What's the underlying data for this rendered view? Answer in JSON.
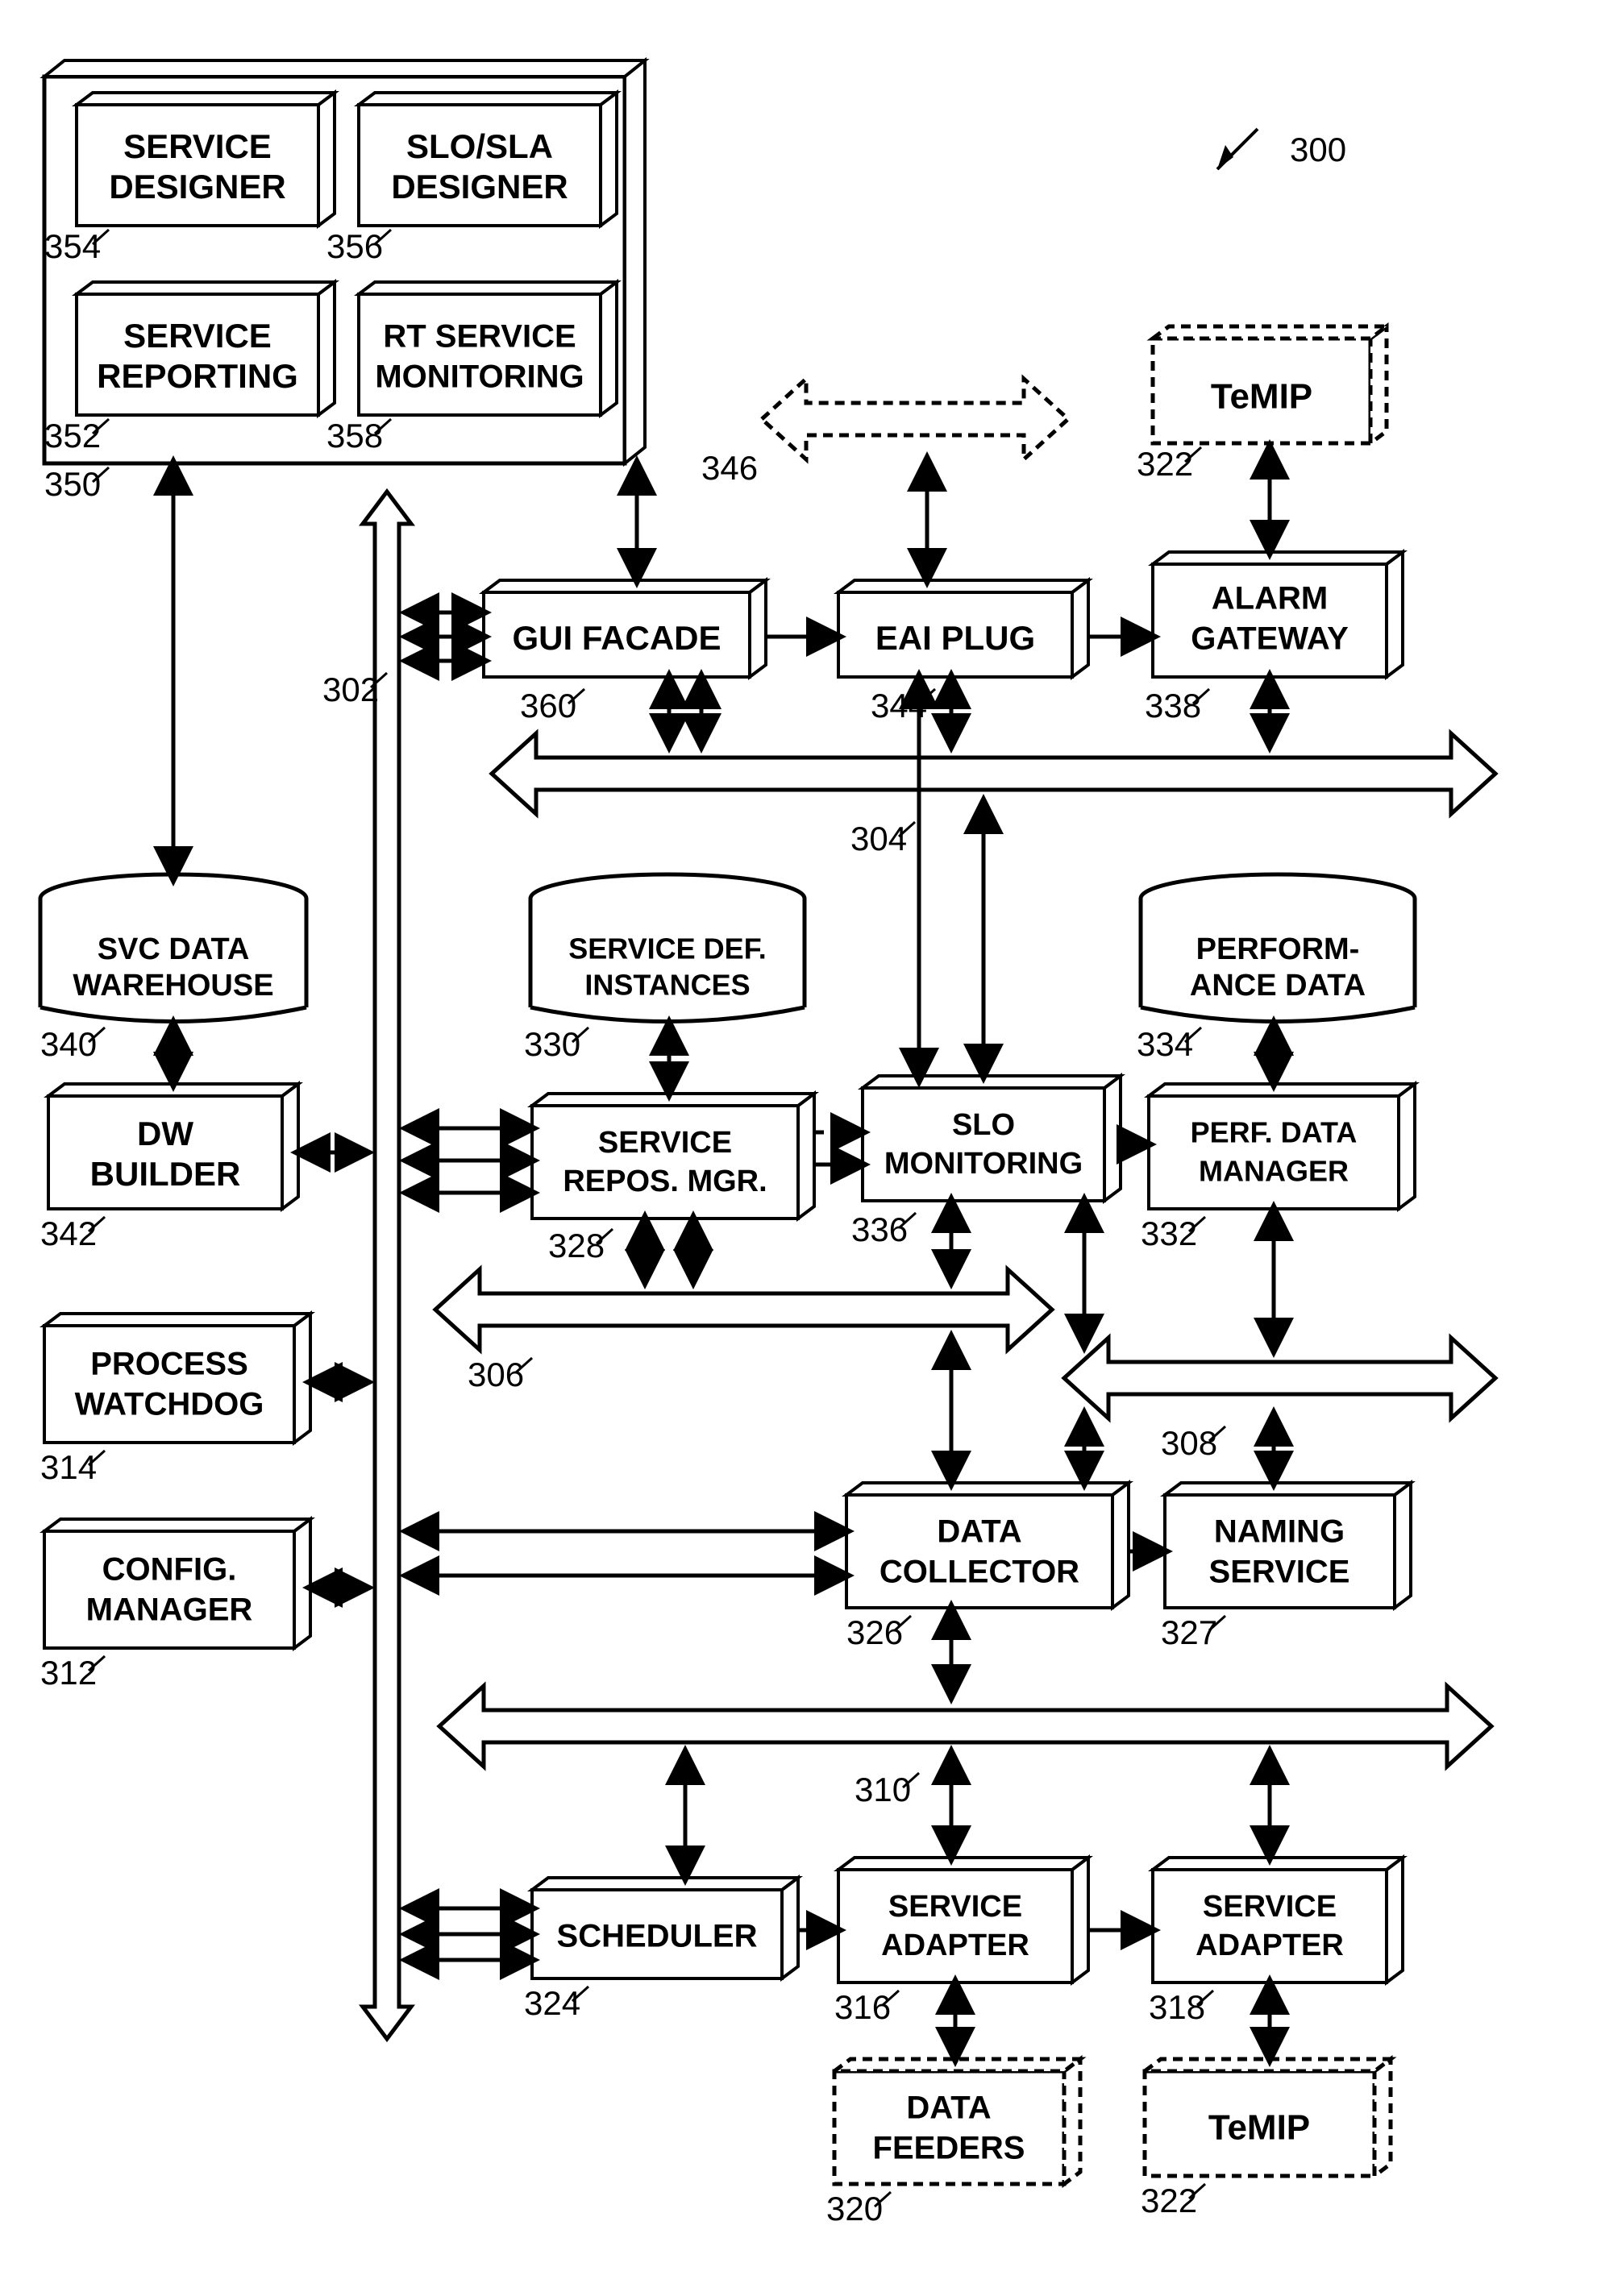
{
  "ref300": "300",
  "boxes": {
    "serviceDesigner": {
      "label1": "SERVICE",
      "label2": "DESIGNER",
      "ref": "354"
    },
    "sloSlaDesigner": {
      "label1": "SLO/SLA",
      "label2": "DESIGNER",
      "ref": "356"
    },
    "serviceReporting": {
      "label1": "SERVICE",
      "label2": "REPORTING",
      "ref": "352"
    },
    "rtServiceMonitoring": {
      "label1": "RT SERVICE",
      "label2": "MONITORING",
      "ref": "358"
    },
    "container350": {
      "ref": "350"
    },
    "guiFacade": {
      "label": "GUI FACADE",
      "ref": "360"
    },
    "eaiPlug": {
      "label": "EAI PLUG",
      "ref": "344"
    },
    "alarmGateway": {
      "label1": "ALARM",
      "label2": "GATEWAY",
      "ref": "338"
    },
    "temip1": {
      "label": "TeMIP",
      "ref": "322"
    },
    "bus302": {
      "ref": "302"
    },
    "bus304": {
      "ref": "304"
    },
    "bus306": {
      "ref": "306"
    },
    "bus308": {
      "ref": "308"
    },
    "bus310": {
      "ref": "310"
    },
    "eaiBus346": {
      "ref": "346"
    },
    "svcDataWarehouse": {
      "label1": "SVC DATA",
      "label2": "WAREHOUSE",
      "ref": "340"
    },
    "dwBuilder": {
      "label1": "DW",
      "label2": "BUILDER",
      "ref": "342"
    },
    "processWatchdog": {
      "label1": "PROCESS",
      "label2": "WATCHDOG",
      "ref": "314"
    },
    "configManager": {
      "label1": "CONFIG.",
      "label2": "MANAGER",
      "ref": "312"
    },
    "serviceDefInstances": {
      "label1": "SERVICE DEF.",
      "label2": "INSTANCES",
      "ref": "330"
    },
    "serviceReposMgr": {
      "label1": "SERVICE",
      "label2": "REPOS. MGR.",
      "ref": "328"
    },
    "sloMonitoring": {
      "label1": "SLO",
      "label2": "MONITORING",
      "ref": "336"
    },
    "perfDataManager": {
      "label1": "PERF. DATA",
      "label2": "MANAGER",
      "ref": "332"
    },
    "performanceData": {
      "label1": "PERFORM-",
      "label2": "ANCE DATA",
      "ref": "334"
    },
    "dataCollector": {
      "label1": "DATA",
      "label2": "COLLECTOR",
      "ref": "326"
    },
    "namingService": {
      "label1": "NAMING",
      "label2": "SERVICE",
      "ref": "327"
    },
    "scheduler": {
      "label": "SCHEDULER",
      "ref": "324"
    },
    "serviceAdapter1": {
      "label1": "SERVICE",
      "label2": "ADAPTER",
      "ref": "316"
    },
    "serviceAdapter2": {
      "label1": "SERVICE",
      "label2": "ADAPTER",
      "ref": "318"
    },
    "dataFeeders": {
      "label1": "DATA",
      "label2": "FEEDERS",
      "ref": "320"
    },
    "temip2": {
      "label": "TeMIP",
      "ref": "322"
    }
  }
}
